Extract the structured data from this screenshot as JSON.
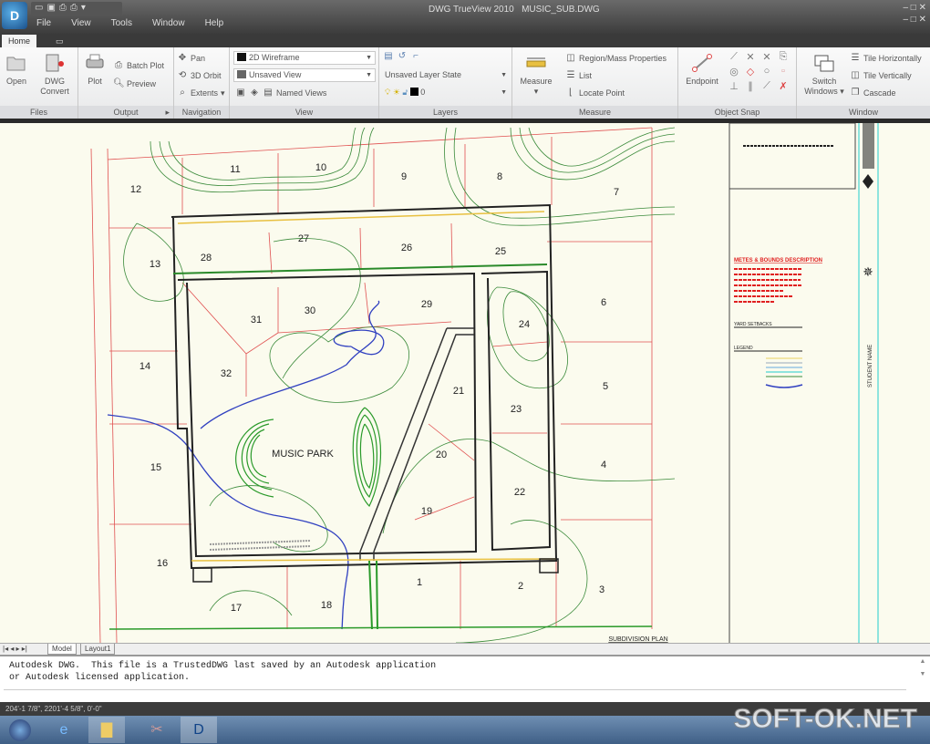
{
  "window": {
    "title": "DWG TrueView 2010",
    "document": "MUSIC_SUB.DWG",
    "app_icon": "autodesk-logo"
  },
  "menu": [
    "File",
    "View",
    "Tools",
    "Window",
    "Help"
  ],
  "ribbon_tabs": [
    "Home"
  ],
  "panels": {
    "files": {
      "title": "Files",
      "open": "Open",
      "dwg_convert_1": "DWG",
      "dwg_convert_2": "Convert"
    },
    "output": {
      "title": "Output",
      "plot": "Plot",
      "batch_plot": "Batch Plot",
      "preview": "Preview"
    },
    "navigation": {
      "title": "Navigation",
      "pan": "Pan",
      "orbit": "3D Orbit",
      "extents": "Extents"
    },
    "view": {
      "title": "View",
      "visual_style": "2D Wireframe",
      "named_view": "Unsaved View",
      "named_views": "Named Views"
    },
    "layers": {
      "title": "Layers",
      "layer_state": "Unsaved Layer State",
      "current_layer": "0"
    },
    "measure": {
      "title": "Measure",
      "measure": "Measure",
      "region": "Region/Mass Properties",
      "list": "List",
      "locate": "Locate Point"
    },
    "osnap": {
      "title": "Object Snap",
      "endpoint": "Endpoint"
    },
    "window": {
      "title": "Window",
      "switch_1": "Switch",
      "switch_2": "Windows",
      "tile_h": "Tile Horizontally",
      "tile_v": "Tile Vertically",
      "cascade": "Cascade"
    }
  },
  "drawing": {
    "park_label": "MUSIC PARK",
    "lots": [
      "1",
      "2",
      "3",
      "4",
      "5",
      "6",
      "7",
      "8",
      "9",
      "10",
      "11",
      "12",
      "13",
      "14",
      "15",
      "16",
      "17",
      "18",
      "19",
      "20",
      "21",
      "22",
      "23",
      "24",
      "25",
      "26",
      "27",
      "28",
      "29",
      "30",
      "31",
      "32"
    ],
    "plan_label": "SUBDIVISION PLAN",
    "metes_title": "METES & BOUNDS DESCRIPTION",
    "setbacks_title": "YARD SETBACKS",
    "legend_title": "LEGEND",
    "student_name": "STUDENT NAME",
    "colors": {
      "lot_lines": "#e05050",
      "contours": "#3a8a3a",
      "creek": "#3040c0",
      "road": "#222222",
      "sheet": "#fbfbee"
    }
  },
  "layout_tabs": [
    "Model",
    "Layout1"
  ],
  "command": {
    "history": "Autodesk DWG.  This file is a TrustedDWG last saved by an Autodesk application\nor Autodesk licensed application.",
    "input": ""
  },
  "status": {
    "coords": "204'-1 7/8\", 2201'-4 5/8\", 0'-0\""
  },
  "taskbar": {
    "items": [
      "start-orb",
      "internet-explorer",
      "windows-explorer",
      "paint-app",
      "dwg-trueview"
    ]
  },
  "watermark": "SOFT-OK.NET"
}
